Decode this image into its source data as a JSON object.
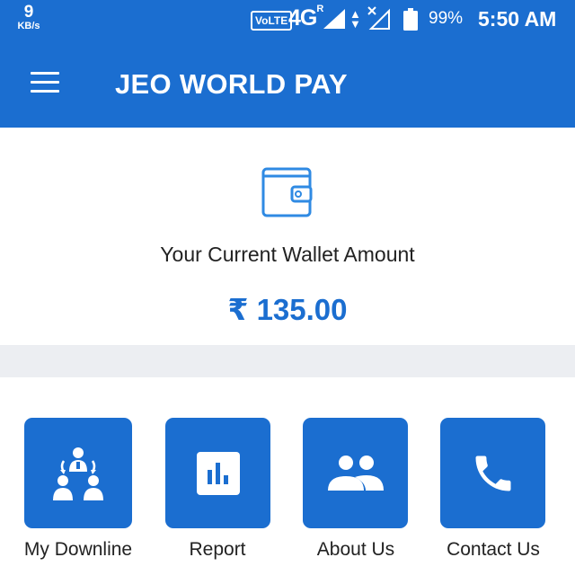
{
  "status_bar": {
    "speed_value": "9",
    "speed_unit": "KB/s",
    "volte": "VoLTE",
    "network": "4G",
    "roaming": "R",
    "battery_percent": "99%",
    "time": "5:50 AM"
  },
  "app_bar": {
    "title": "JEO WORLD PAY",
    "menu_icon": "hamburger-menu-icon"
  },
  "wallet": {
    "icon": "wallet-icon",
    "label": "Your Current Wallet Amount",
    "amount": "₹ 135.00"
  },
  "tiles": [
    {
      "label": "My Downline",
      "icon": "downline-icon"
    },
    {
      "label": "Report",
      "icon": "report-chart-icon"
    },
    {
      "label": "About Us",
      "icon": "people-icon"
    },
    {
      "label": "Contact Us",
      "icon": "phone-icon"
    }
  ],
  "colors": {
    "primary": "#1b6ed0",
    "background": "#ffffff",
    "divider": "#eceef2",
    "text": "#222222"
  }
}
